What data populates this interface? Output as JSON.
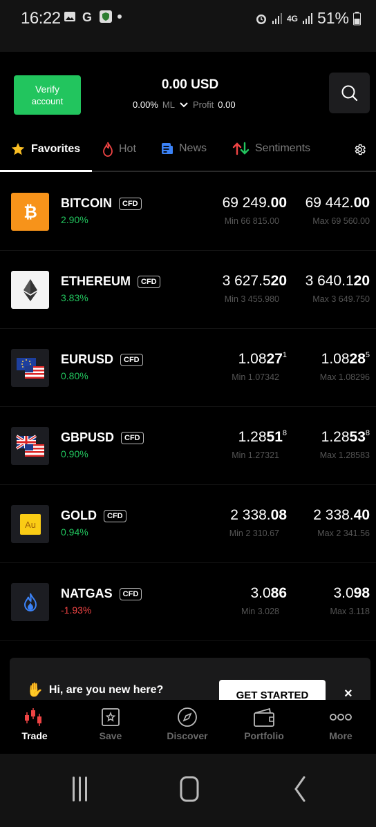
{
  "status_bar": {
    "time": "16:22",
    "battery": "51%",
    "network": "4G"
  },
  "header": {
    "verify_line1": "Verify",
    "verify_line2": "account",
    "balance": "0.00 USD",
    "ml_value": "0.00%",
    "ml_label": "ML",
    "profit_label": "Profit",
    "profit_value": "0.00"
  },
  "tabs": [
    {
      "label": "Favorites",
      "icon": "star-icon",
      "active": true
    },
    {
      "label": "Hot",
      "icon": "flame-icon",
      "active": false
    },
    {
      "label": "News",
      "icon": "news-icon",
      "active": false
    },
    {
      "label": "Sentiments",
      "icon": "sentiments-icon",
      "active": false
    }
  ],
  "instruments": [
    {
      "name": "BITCOIN",
      "badge": "CFD",
      "change": "2.90%",
      "bid_main": "69 249.",
      "bid_bold": "00",
      "bid_sup": "",
      "ask_main": "69 442.",
      "ask_bold": "00",
      "ask_sup": "",
      "min": "Min 66 815.00",
      "max": "Max 69 560.00"
    },
    {
      "name": "ETHEREUM",
      "badge": "CFD",
      "change": "3.83%",
      "bid_main": "3 627.5",
      "bid_bold": "20",
      "bid_sup": "",
      "ask_main": "3 640.1",
      "ask_bold": "20",
      "ask_sup": "",
      "min": "Min 3 455.980",
      "max": "Max 3 649.750"
    },
    {
      "name": "EURUSD",
      "badge": "CFD",
      "change": "0.80%",
      "bid_main": "1.08",
      "bid_bold": "27",
      "bid_sup": "1",
      "ask_main": "1.08",
      "ask_bold": "28",
      "ask_sup": "5",
      "min": "Min 1.07342",
      "max": "Max 1.08296"
    },
    {
      "name": "GBPUSD",
      "badge": "CFD",
      "change": "0.90%",
      "bid_main": "1.28",
      "bid_bold": "51",
      "bid_sup": "8",
      "ask_main": "1.28",
      "ask_bold": "53",
      "ask_sup": "8",
      "min": "Min 1.27321",
      "max": "Max 1.28583"
    },
    {
      "name": "GOLD",
      "badge": "CFD",
      "change": "0.94%",
      "bid_main": "2 338.",
      "bid_bold": "08",
      "bid_sup": "",
      "ask_main": "2 338.",
      "ask_bold": "40",
      "ask_sup": "",
      "min": "Min 2 310.67",
      "max": "Max 2 341.56"
    },
    {
      "name": "NATGAS",
      "badge": "CFD",
      "change": "-1.93%",
      "bid_main": "3.0",
      "bid_bold": "86",
      "bid_sup": "",
      "ask_main": "3.0",
      "ask_bold": "98",
      "ask_sup": "",
      "min": "Min 3.028",
      "max": "Max 3.118"
    }
  ],
  "banner": {
    "text": "Hi, are you new here?",
    "button": "GET STARTED",
    "close": "×"
  },
  "bottom_nav": [
    {
      "label": "Trade",
      "icon": "trade-icon",
      "active": true
    },
    {
      "label": "Save",
      "icon": "save-icon",
      "active": false
    },
    {
      "label": "Discover",
      "icon": "discover-icon",
      "active": false
    },
    {
      "label": "Portfolio",
      "icon": "portfolio-icon",
      "active": false
    },
    {
      "label": "More",
      "icon": "more-icon",
      "active": false
    }
  ],
  "colors": {
    "accent_green": "#22c55e",
    "negative_red": "#ef4444",
    "background": "#000000"
  }
}
